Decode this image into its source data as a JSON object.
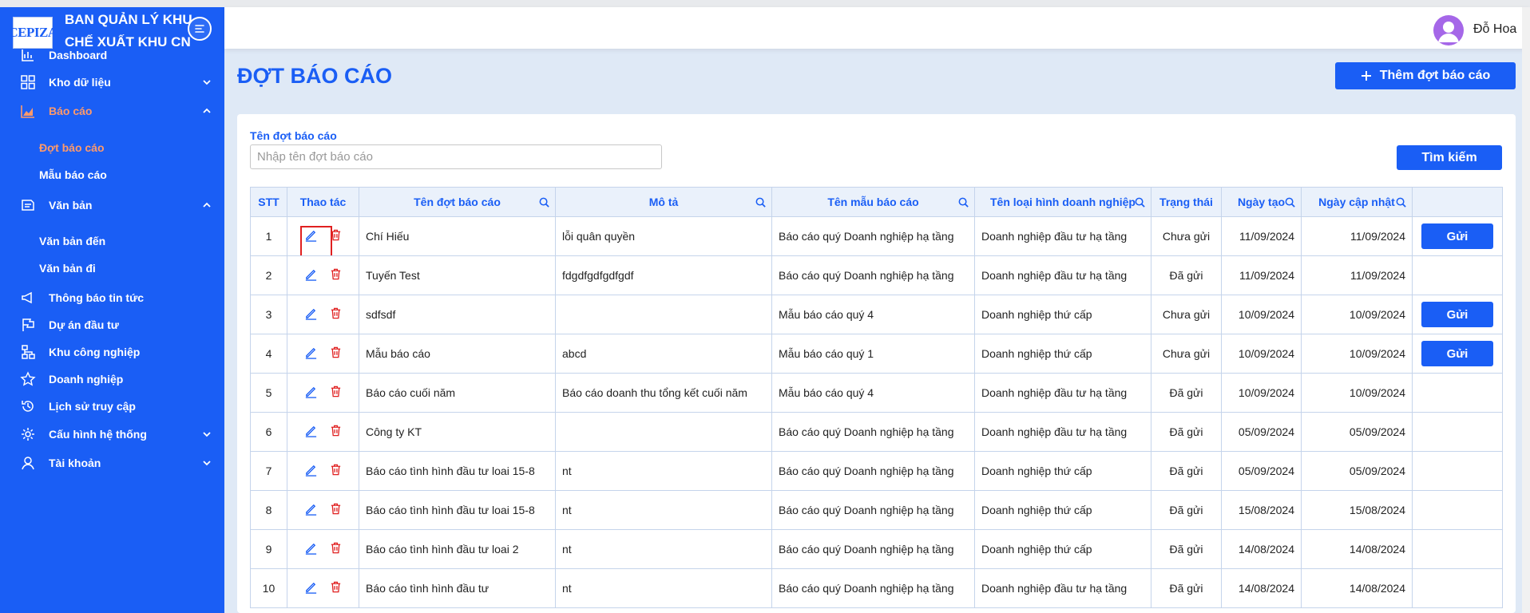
{
  "brand": {
    "logo_text": "CEPIZA",
    "line1": "BAN QUẢN LÝ KHU",
    "line2": "CHẾ XUẤT KHU CN"
  },
  "user": {
    "name": "Đỗ Hoa"
  },
  "nav": {
    "dashboard": "Dashboard",
    "kho_du_lieu": "Kho dữ liệu",
    "bao_cao": "Báo cáo",
    "dot_bao_cao": "Đợt báo cáo",
    "mau_bao_cao": "Mẫu báo cáo",
    "van_ban": "Văn bản",
    "van_ban_den": "Văn bản đến",
    "van_ban_di": "Văn bản đi",
    "thong_bao": "Thông báo tin tức",
    "du_an": "Dự án đầu tư",
    "khu_cong_nghiep": "Khu công nghiệp",
    "doanh_nghiep": "Doanh nghiệp",
    "lich_su": "Lịch sử truy cập",
    "cau_hinh": "Cấu hình hệ thống",
    "tai_khoan": "Tài khoản"
  },
  "page": {
    "title": "ĐỢT BÁO CÁO",
    "add_label": "Thêm đợt báo cáo",
    "filter_label": "Tên đợt báo cáo",
    "filter_placeholder": "Nhập tên đợt báo cáo",
    "search_label": "Tìm kiếm"
  },
  "table": {
    "headers": [
      "STT",
      "Thao tác",
      "Tên đợt báo cáo",
      "Mô tả",
      "Tên mẫu báo cáo",
      "Tên loại hình doanh nghiệp",
      "Trạng thái",
      "Ngày tạo",
      "Ngày cập nhật",
      ""
    ],
    "send_label": "Gửi",
    "rows": [
      {
        "stt": "1",
        "name": "Chí Hiếu",
        "desc": "lỗi quân quyền",
        "template": "Báo cáo quý Doanh nghiệp hạ tầng",
        "type": "Doanh nghiệp đầu tư hạ tầng",
        "status": "Chưa gửi",
        "created": "11/09/2024",
        "updated": "11/09/2024"
      },
      {
        "stt": "2",
        "name": "Tuyến Test",
        "desc": "fdgdfgdfgdfgdf",
        "template": "Báo cáo quý Doanh nghiệp hạ tầng",
        "type": "Doanh nghiệp đầu tư hạ tầng",
        "status": "Đã gửi",
        "created": "11/09/2024",
        "updated": "11/09/2024"
      },
      {
        "stt": "3",
        "name": "sdfsdf",
        "desc": "",
        "template": "Mẫu báo cáo quý 4",
        "type": "Doanh nghiệp thứ cấp",
        "status": "Chưa gửi",
        "created": "10/09/2024",
        "updated": "10/09/2024"
      },
      {
        "stt": "4",
        "name": "Mẫu báo cáo",
        "desc": "abcd",
        "template": "Mẫu báo cáo quý 1",
        "type": "Doanh nghiệp thứ cấp",
        "status": "Chưa gửi",
        "created": "10/09/2024",
        "updated": "10/09/2024"
      },
      {
        "stt": "5",
        "name": "Báo cáo cuối năm",
        "desc": "Báo cáo doanh thu tổng kết cuối năm",
        "template": "Mẫu báo cáo quý 4",
        "type": "Doanh nghiệp đầu tư hạ tầng",
        "status": "Đã gửi",
        "created": "10/09/2024",
        "updated": "10/09/2024"
      },
      {
        "stt": "6",
        "name": "Công ty KT",
        "desc": "",
        "template": "Báo cáo quý Doanh nghiệp hạ tầng",
        "type": "Doanh nghiệp đầu tư hạ tầng",
        "status": "Đã gửi",
        "created": "05/09/2024",
        "updated": "05/09/2024"
      },
      {
        "stt": "7",
        "name": "Báo cáo tình hình đầu tư loai 15-8",
        "desc": "nt",
        "template": "Báo cáo quý Doanh nghiệp hạ tầng",
        "type": "Doanh nghiệp thứ cấp",
        "status": "Đã gửi",
        "created": "05/09/2024",
        "updated": "05/09/2024"
      },
      {
        "stt": "8",
        "name": "Báo cáo tình hình đầu tư loai 15-8",
        "desc": "nt",
        "template": "Báo cáo quý Doanh nghiệp hạ tầng",
        "type": "Doanh nghiệp thứ cấp",
        "status": "Đã gửi",
        "created": "15/08/2024",
        "updated": "15/08/2024"
      },
      {
        "stt": "9",
        "name": "Báo cáo tình hình đầu tư loai 2",
        "desc": "nt",
        "template": "Báo cáo quý Doanh nghiệp hạ tầng",
        "type": "Doanh nghiệp thứ cấp",
        "status": "Đã gửi",
        "created": "14/08/2024",
        "updated": "14/08/2024"
      },
      {
        "stt": "10",
        "name": "Báo cáo tình hình đầu tư",
        "desc": "nt",
        "template": "Báo cáo quý Doanh nghiệp hạ tầng",
        "type": "Doanh nghiệp đầu tư hạ tầng",
        "status": "Đã gửi",
        "created": "14/08/2024",
        "updated": "14/08/2024"
      }
    ]
  },
  "colors": {
    "primary": "#1a5ef5",
    "active_nav": "#ff9a6b",
    "pending": "#21a33a",
    "sent": "#f08a10",
    "delete": "#e02020"
  },
  "icons": [
    "hamburger-icon",
    "dashboard-icon",
    "grid-icon",
    "chart-icon",
    "document-icon",
    "megaphone-icon",
    "flag-icon",
    "network-icon",
    "star-icon",
    "history-icon",
    "gear-icon",
    "user-icon",
    "chevron-down-icon",
    "chevron-up-icon",
    "plus-icon",
    "search-icon",
    "edit-icon",
    "trash-icon",
    "avatar-icon"
  ]
}
